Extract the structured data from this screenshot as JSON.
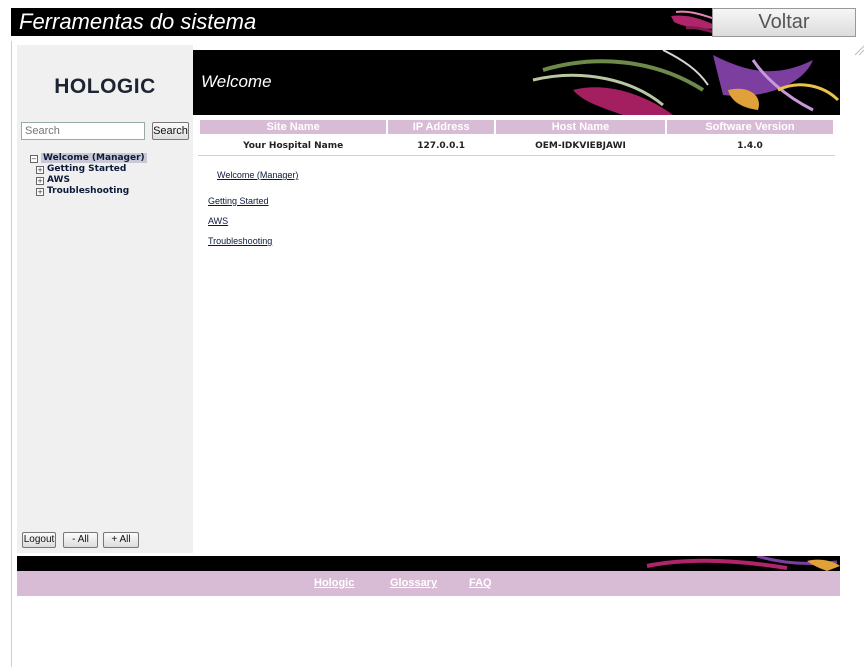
{
  "titlebar": {
    "title": "Ferramentas do sistema",
    "back_label": "Voltar"
  },
  "left": {
    "logo": "HOLOGIC",
    "search": {
      "placeholder": "Search",
      "button_label": "Search"
    },
    "tree": {
      "root": "Welcome (Manager)",
      "children": [
        "Getting Started",
        "AWS",
        "Troubleshooting"
      ]
    },
    "buttons": {
      "logout": "Logout",
      "collapse_all": "- All",
      "expand_all": "+ All"
    }
  },
  "banner": {
    "title": "Welcome"
  },
  "info_table": {
    "headers": [
      "Site Name",
      "IP Address",
      "Host Name",
      "Software Version"
    ],
    "row": [
      "Your Hospital Name",
      "127.0.0.1",
      "OEM-IDKVIEBJAWI",
      "1.4.0"
    ]
  },
  "content_links": {
    "welcome": "Welcome (Manager)",
    "getting_started": "Getting Started",
    "aws": "AWS",
    "troubleshooting": "Troubleshooting"
  },
  "footer": {
    "links": [
      "Hologic",
      "Glossary",
      "FAQ"
    ]
  },
  "colors": {
    "accent": "#d8bcd5",
    "bar": "#000000",
    "panel": "#f0f0f0"
  },
  "icons": {
    "tree_expanded": "minus-box-icon",
    "tree_collapsed": "plus-box-icon",
    "scroll": "resize-corner-icon"
  }
}
